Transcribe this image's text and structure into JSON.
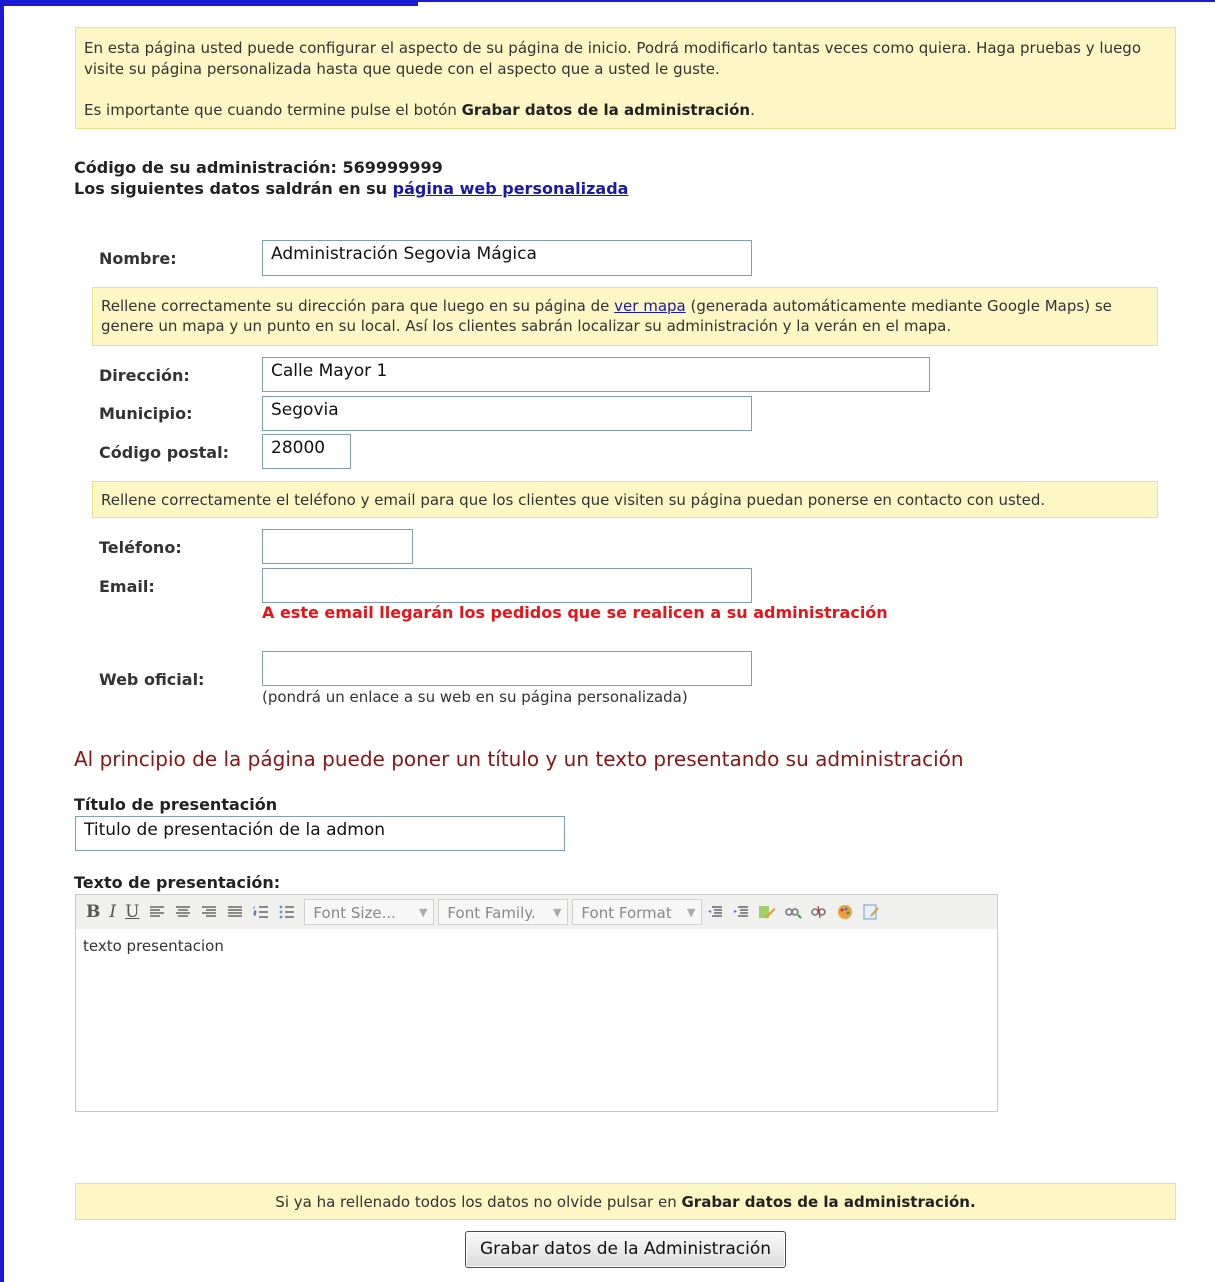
{
  "intro": {
    "text1": "En esta página usted puede configurar el aspecto de su página de inicio. Podrá modificarlo tantas veces como quiera. Haga pruebas y luego visite su página personalizada hasta que quede con el aspecto que a usted le guste.",
    "text2_prefix": "Es importante que cuando termine pulse el botón ",
    "text2_bold": "Grabar datos de la administración",
    "text2_suffix": "."
  },
  "code": {
    "label": "Código de su administración: 569999999",
    "line2_prefix": "Los siguientes datos saldrán en su ",
    "line2_link": "página web personalizada"
  },
  "form": {
    "nombre_label": "Nombre:",
    "nombre_value": "Administración Segovia Mágica",
    "map_note_prefix": "Rellene correctamente su dirección para que luego en su página de ",
    "map_note_link": "ver mapa",
    "map_note_suffix": " (generada automáticamente mediante Google Maps) se genere un mapa y un punto en su local. Así los clientes sabrán localizar su administración y la verán en el mapa.",
    "direccion_label": "Dirección:",
    "direccion_value": "Calle Mayor 1",
    "municipio_label": "Municipio:",
    "municipio_value": "Segovia",
    "cp_label": "Código postal:",
    "cp_value": "28000",
    "contact_note": "Rellene correctamente el teléfono y email para que los clientes que visiten su página puedan ponerse en contacto con usted.",
    "telefono_label": "Teléfono:",
    "telefono_value": "",
    "email_label": "Email:",
    "email_value": "",
    "email_warning": "A este email llegarán los pedidos que se realicen a su administración",
    "web_label": "Web oficial:",
    "web_value": "",
    "web_hint": "(pondrá un enlace a su web en su página personalizada)"
  },
  "presentation": {
    "section_title": "Al principio de la página puede poner un título y un texto presentando su administración",
    "titulo_label": "Título de presentación",
    "titulo_value": "Titulo de presentación de la admon",
    "texto_label": "Texto de presentación:",
    "toolbar": {
      "font_size": "Font Size...",
      "font_family": "Font Family.",
      "font_format": "Font Format"
    },
    "texto_value": "texto presentacion"
  },
  "footer": {
    "note_prefix": "Si ya ha rellenado todos los datos no olvide pulsar en ",
    "note_bold": "Grabar datos de la administración.",
    "submit_label": "Grabar datos de la Administración"
  },
  "colors": {
    "note_bg": "#fdf7c6",
    "warning": "#e8141a",
    "section_title": "#8b1414",
    "frame": "#1a1ad6"
  }
}
